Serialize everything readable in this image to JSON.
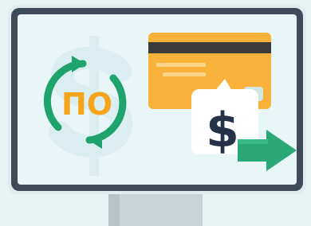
{
  "illustration": {
    "po_label": "ПО",
    "dollar_symbol": "$",
    "icons": {
      "monitor": "monitor-icon",
      "refresh": "refresh-arrows-icon",
      "background_dollar": "dollar-watermark-icon",
      "card": "credit-card-icon",
      "speech_bubble": "speech-bubble-icon",
      "arrow": "arrow-right-icon"
    },
    "colors": {
      "background": "#e9f3f4",
      "monitor_frame": "#3e4b5a",
      "screen": "#e8f6f7",
      "stand": "#c9d3d6",
      "green": "#1fa36d",
      "orange": "#f6a51a",
      "card": "#f8b23a",
      "card_stripe": "#3b3b3b",
      "bubble": "#ffffff",
      "dark_symbol": "#24324a"
    }
  }
}
